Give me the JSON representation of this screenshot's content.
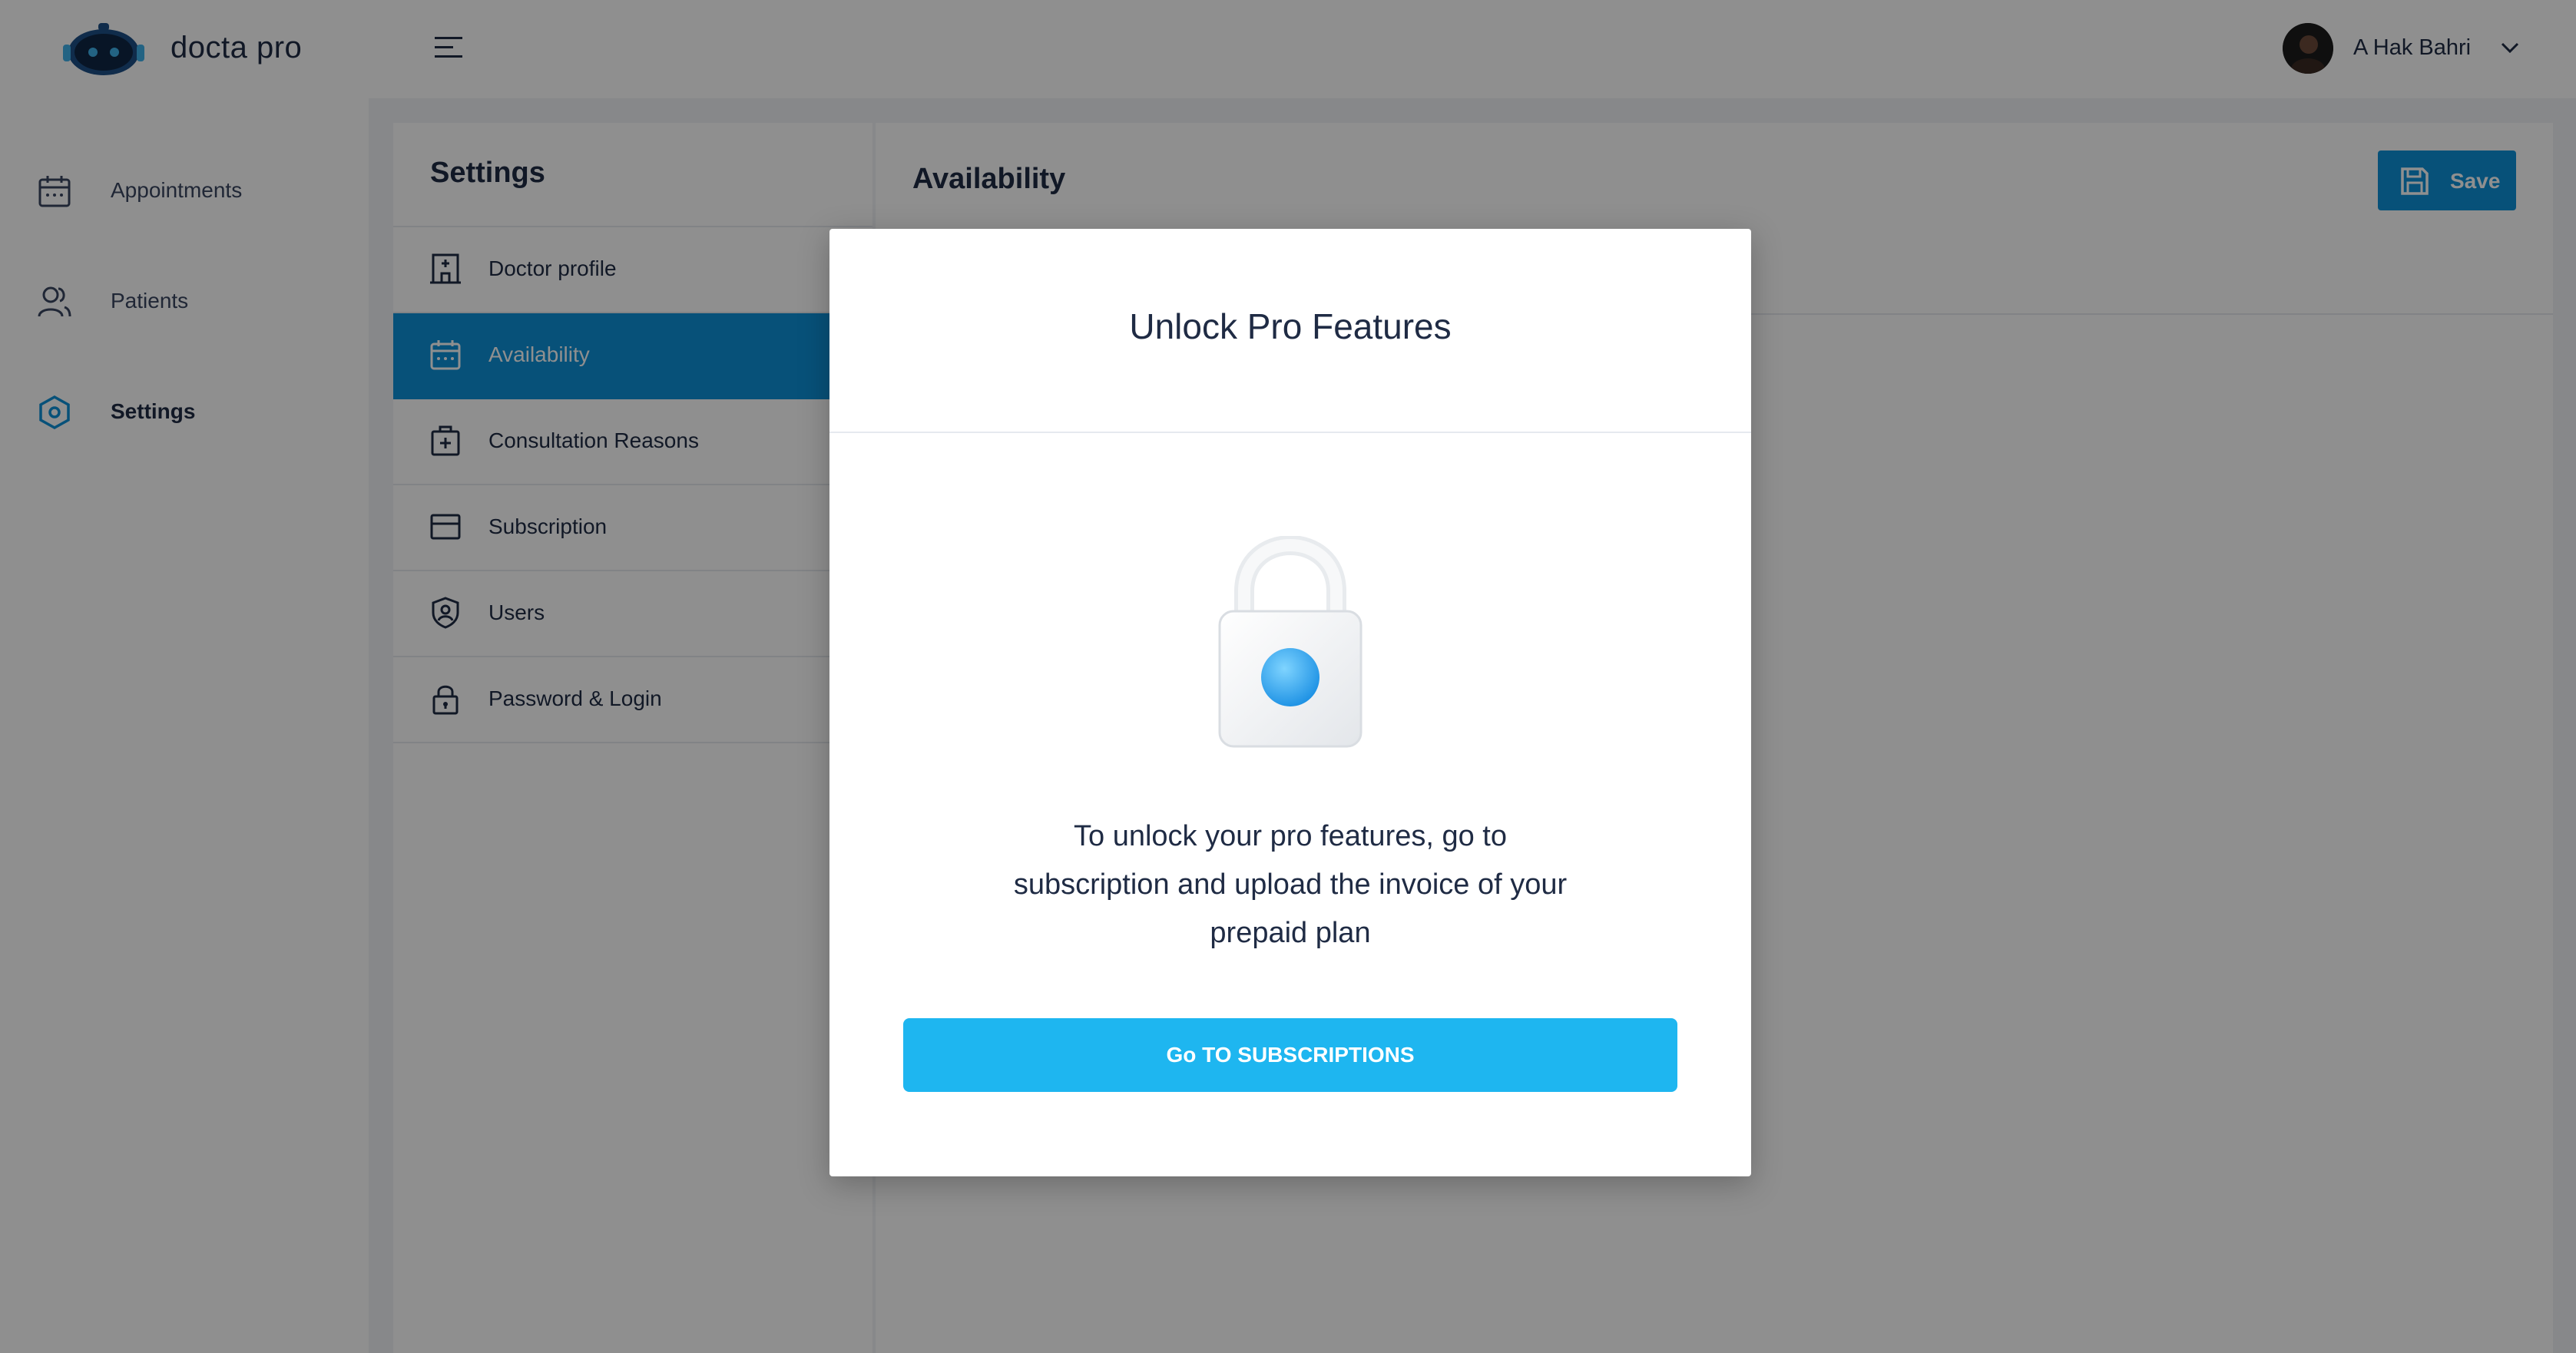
{
  "app": {
    "brand": "docta pro",
    "logo_icon": "robot-logo-icon",
    "menu_icon": "hamburger-menu-icon"
  },
  "user": {
    "name": "A Hak Bahri",
    "chevron_icon": "chevron-down-icon"
  },
  "leftnav": {
    "items": [
      {
        "label": "Appointments",
        "icon": "calendar-icon"
      },
      {
        "label": "Patients",
        "icon": "users-icon"
      },
      {
        "label": "Settings",
        "icon": "hexagon-settings-icon",
        "active": true
      }
    ]
  },
  "settings": {
    "title": "Settings",
    "items": [
      {
        "label": "Doctor profile",
        "icon": "hospital-building-icon"
      },
      {
        "label": "Availability",
        "icon": "calendar-icon",
        "active": true
      },
      {
        "label": "Consultation Reasons",
        "icon": "medical-kit-icon"
      },
      {
        "label": "Subscription",
        "icon": "card-icon"
      },
      {
        "label": "Users",
        "icon": "shield-user-icon"
      },
      {
        "label": "Password & Login",
        "icon": "lock-icon"
      }
    ]
  },
  "availability": {
    "title": "Availability",
    "save_label": "Save",
    "save_icon": "floppy-disk-icon"
  },
  "modal": {
    "title": "Unlock Pro Features",
    "illustration": "padlock-icon",
    "message_lines": [
      "To unlock your pro features, go to",
      "subscription and upload the invoice of your",
      "prepaid plan"
    ],
    "button_label": "Go TO SUBSCRIPTIONS"
  },
  "colors": {
    "primary": "#0d90d8",
    "cta": "#1eb6f0",
    "text": "#1f2b44",
    "overlay": "rgba(0,0,0,0.44)"
  }
}
